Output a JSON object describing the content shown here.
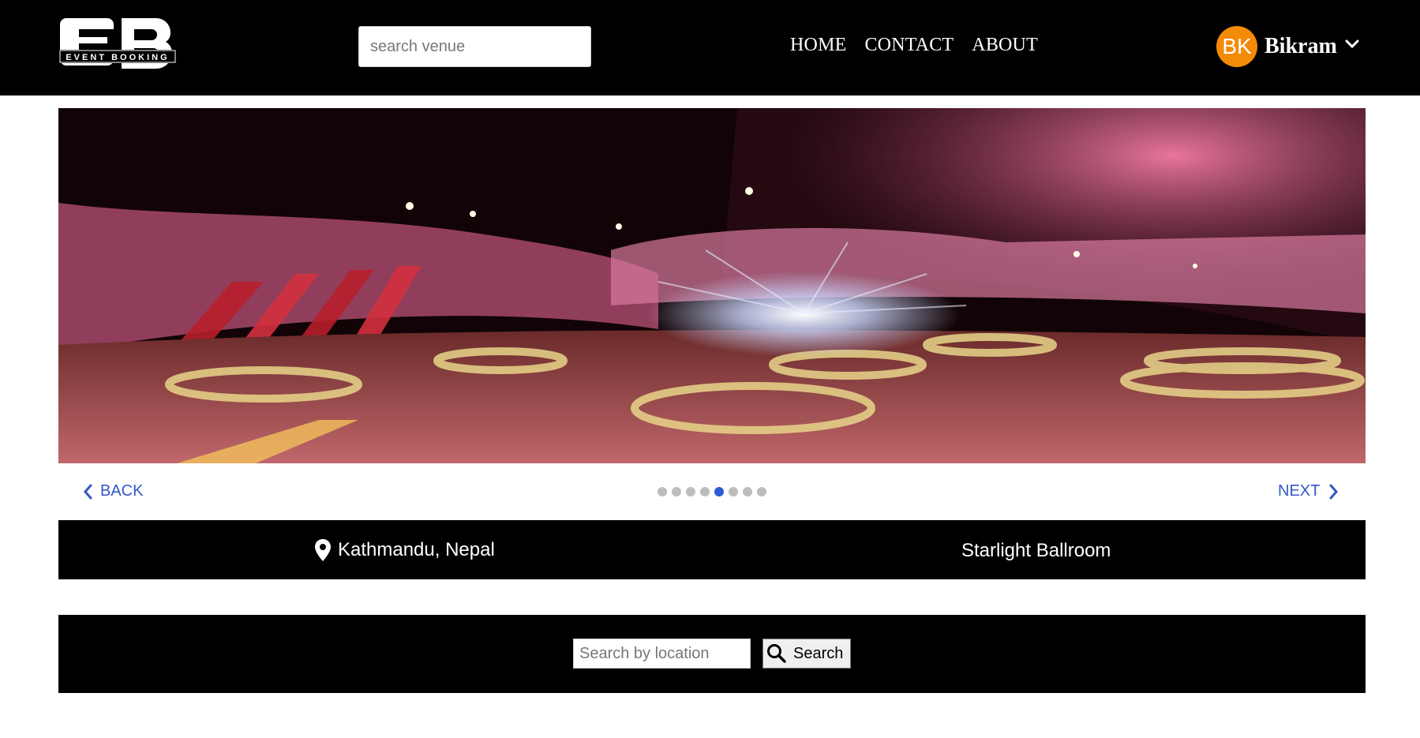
{
  "header": {
    "logo_text": "EVENT BOOKING",
    "search_placeholder": "search venue",
    "nav": [
      "HOME",
      "CONTACT",
      "ABOUT"
    ],
    "user": {
      "initials": "BK",
      "name": "Bikram",
      "avatar_color": "#f58a07"
    }
  },
  "carousel": {
    "back_label": "BACK",
    "next_label": "NEXT",
    "slide_count": 8,
    "active_slide": 5,
    "accent_color": "#3357c9"
  },
  "venue": {
    "location": "Kathmandu, Nepal",
    "name": "Starlight Ballroom"
  },
  "location_search": {
    "placeholder": "Search by location",
    "button_label": "Search"
  }
}
